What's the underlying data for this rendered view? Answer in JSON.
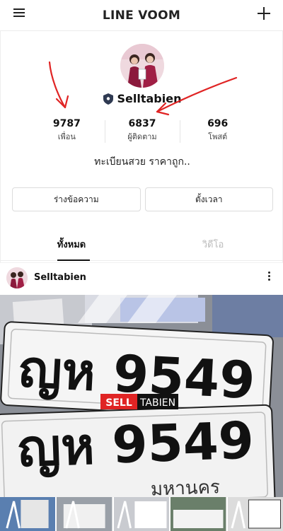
{
  "header": {
    "title": "LINE VOOM",
    "menu_icon": "hamburger-menu-icon",
    "add_icon": "plus-icon"
  },
  "profile": {
    "name": "Selltabien",
    "badge_icon": "shield-badge-icon",
    "stats": [
      {
        "value": "9787",
        "label": "เพื่อน"
      },
      {
        "value": "6837",
        "label": "ผู้ติดตาม"
      },
      {
        "value": "696",
        "label": "โพสต์"
      }
    ],
    "bio": "ทะเบียนสวย ราคาถูก..",
    "actions": {
      "message_label": "ร่างข้อความ",
      "schedule_label": "ตั้งเวลา"
    },
    "tabs": [
      {
        "label": "ทั้งหมด",
        "active": true
      },
      {
        "label": "วิดีโอ",
        "active": false
      }
    ]
  },
  "post": {
    "author": "Selltabien",
    "plate_number": "ญห 9549",
    "plate_province_partial": "มหานคร",
    "watermark_sell": "SELL",
    "watermark_tabien": "TABIEN"
  },
  "colors": {
    "accent_red": "#e02424",
    "plate_black": "#111111",
    "divider": "#ececec"
  }
}
